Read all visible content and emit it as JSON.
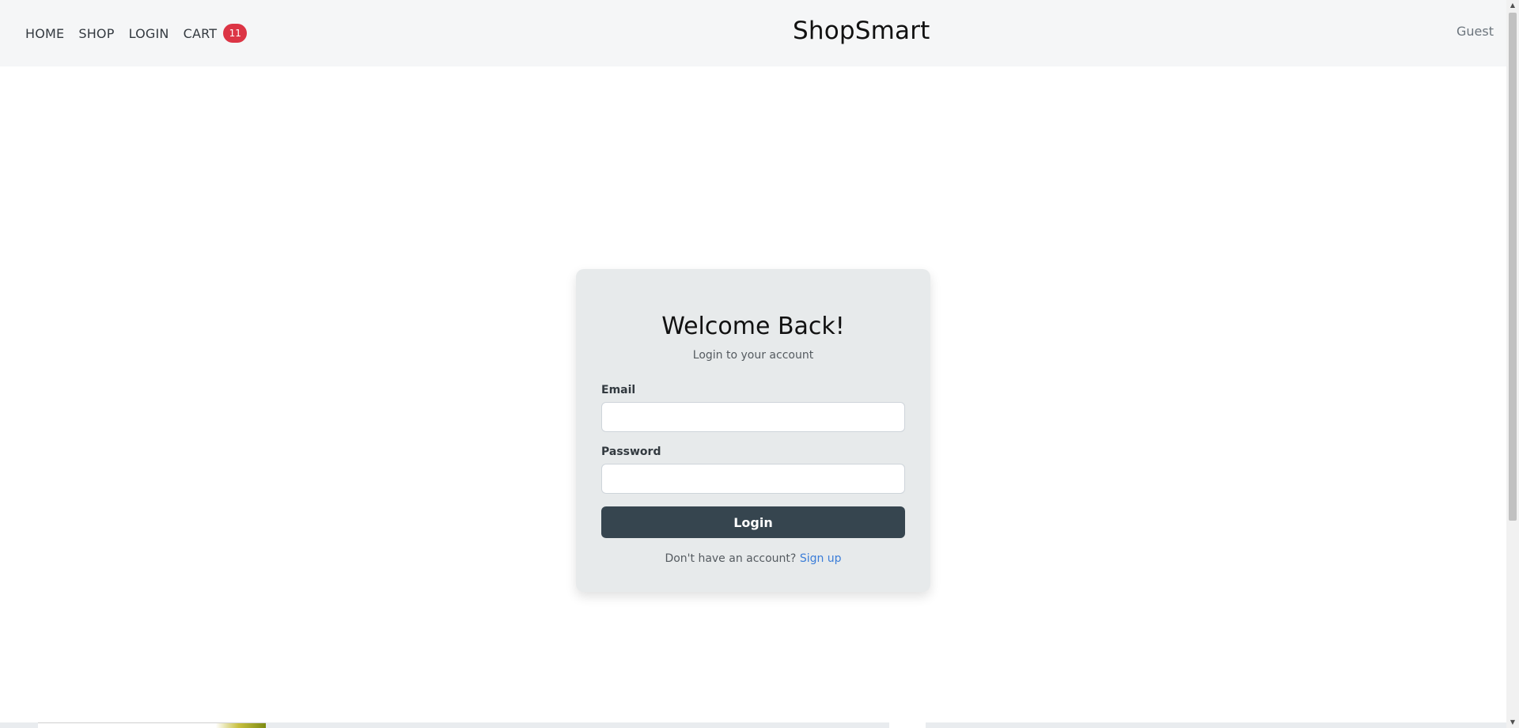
{
  "navbar": {
    "links": {
      "home": "HOME",
      "shop": "SHOP",
      "login": "LOGIN",
      "cart": "CART"
    },
    "cart_count": "11",
    "brand": "ShopSmart",
    "user": "Guest"
  },
  "login_card": {
    "title": "Welcome Back!",
    "subtitle": "Login to your account",
    "email_label": "Email",
    "email_value": "",
    "password_label": "Password",
    "password_value": "",
    "submit_label": "Login",
    "signup_prompt": "Don't have an account?",
    "signup_link": "Sign up"
  },
  "colors": {
    "navbar_bg": "#f5f6f7",
    "card_bg": "#e7eaeb",
    "button_bg": "#36454f",
    "badge_bg": "#dc3545",
    "link": "#3b7dd8"
  },
  "icons": {
    "scroll_up": "scroll-up-arrow-icon",
    "scroll_down": "scroll-down-arrow-icon"
  }
}
